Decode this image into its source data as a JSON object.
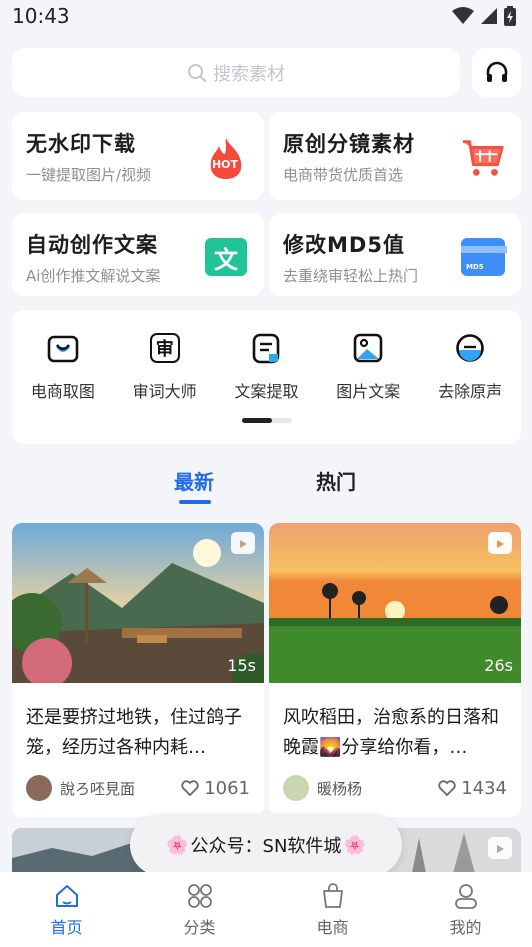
{
  "status_bar": {
    "time": "10:43"
  },
  "search": {
    "placeholder": "搜索素材"
  },
  "features": [
    {
      "title": "无水印下载",
      "subtitle": "一键提取图片/视频",
      "icon": "hot-flame-icon",
      "badge": "HOT"
    },
    {
      "title": "原创分镜素材",
      "subtitle": "电商带货优质首选",
      "icon": "shopping-cart-icon"
    },
    {
      "title": "自动创作文案",
      "subtitle": "Ai创作推文解说文案",
      "icon": "text-wen-icon",
      "badge": "文"
    },
    {
      "title": "修改MD5值",
      "subtitle": "去重绕审轻松上热门",
      "icon": "md5-card-icon",
      "badge": "MD5"
    }
  ],
  "tools": [
    {
      "label": "电商取图",
      "icon": "shop-bag-icon"
    },
    {
      "label": "审词大师",
      "icon": "shen-review-icon",
      "glyph": "审"
    },
    {
      "label": "文案提取",
      "icon": "document-extract-icon"
    },
    {
      "label": "图片文案",
      "icon": "image-text-icon"
    },
    {
      "label": "去除原声",
      "icon": "remove-audio-icon"
    }
  ],
  "tabs": [
    {
      "label": "最新",
      "active": true
    },
    {
      "label": "热门",
      "active": false
    }
  ],
  "posts": [
    {
      "title": "还是要挤过地铁，住过鸽子笼，经历过各种内耗…",
      "author": "說ろ呸見面",
      "likes": "1061",
      "duration": "15s"
    },
    {
      "title": "风吹稻田，治愈系的日落和晚霞🌄分享给你看，…",
      "author": "暖杨杨",
      "likes": "1434",
      "duration": "26s"
    }
  ],
  "toast": {
    "text": "公众号：SN软件城",
    "decor": "🌸"
  },
  "bottom_nav": [
    {
      "label": "首页",
      "icon": "home-icon",
      "active": true
    },
    {
      "label": "分类",
      "icon": "grid-category-icon",
      "active": false
    },
    {
      "label": "电商",
      "icon": "shopping-bag-icon",
      "active": false
    },
    {
      "label": "我的",
      "icon": "user-profile-icon",
      "active": false
    }
  ],
  "colors": {
    "accent": "#1e6de6",
    "hot_red": "#f5493a",
    "cart_red": "#f4513f",
    "wen_green": "#22c497",
    "md5_blue": "#3d8ef5"
  }
}
